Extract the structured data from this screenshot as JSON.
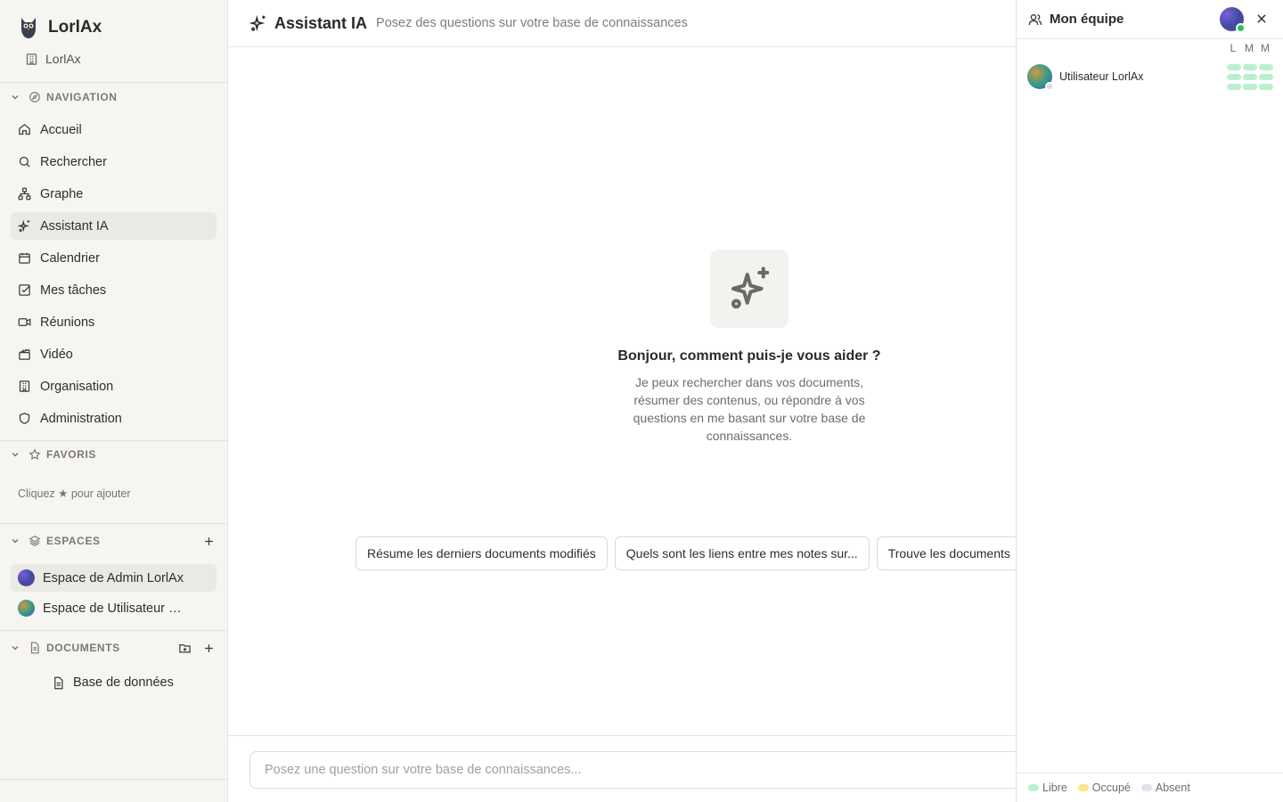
{
  "app": {
    "name": "LorlAx",
    "org": "LorlAx"
  },
  "sidebar": {
    "navigation_label": "NAVIGATION",
    "items": [
      {
        "label": "Accueil",
        "icon": "home-icon"
      },
      {
        "label": "Rechercher",
        "icon": "search-icon"
      },
      {
        "label": "Graphe",
        "icon": "graph-icon"
      },
      {
        "label": "Assistant IA",
        "icon": "sparkles-icon",
        "active": true
      },
      {
        "label": "Calendrier",
        "icon": "calendar-icon"
      },
      {
        "label": "Mes tâches",
        "icon": "checkbox-icon"
      },
      {
        "label": "Réunions",
        "icon": "video-camera-icon"
      },
      {
        "label": "Vidéo",
        "icon": "clapperboard-icon"
      },
      {
        "label": "Organisation",
        "icon": "building-icon"
      },
      {
        "label": "Administration",
        "icon": "shield-icon"
      }
    ],
    "favorites_label": "FAVORIS",
    "favorites_hint": "Cliquez ★ pour ajouter",
    "spaces_label": "ESPACES",
    "spaces": [
      {
        "label": "Espace de Admin LorlAx",
        "active": true
      },
      {
        "label": "Espace de Utilisateur LorlAx",
        "active": false
      }
    ],
    "documents_label": "DOCUMENTS",
    "documents": [
      {
        "label": "Base de données"
      }
    ]
  },
  "header": {
    "title": "Assistant IA",
    "subtitle": "Posez des questions sur votre base de connaissances"
  },
  "main": {
    "greeting": "Bonjour, comment puis-je vous aider ?",
    "description": "Je peux rechercher dans vos documents, résumer des contenus, ou répondre à vos questions en me basant sur votre base de connaissances.",
    "suggestions": [
      "Résume les derniers documents modifiés",
      "Quels sont les liens entre mes notes sur...",
      "Trouve les documents"
    ],
    "composer_placeholder": "Posez une question sur votre base de connaissances..."
  },
  "team_panel": {
    "title": "Mon équipe",
    "days": [
      "L",
      "M",
      "M"
    ],
    "members": [
      {
        "name": "Utilisateur LorlAx",
        "status": "absent"
      }
    ],
    "legend": [
      {
        "label": "Libre",
        "color": "#bbf0cf"
      },
      {
        "label": "Occupé",
        "color": "#fde68a"
      },
      {
        "label": "Absent",
        "color": "#dfe3ea"
      }
    ]
  },
  "colors": {
    "active_bg": "#ebe9e4",
    "sidebar_bg": "#f6f5f2",
    "online": "#22c55e"
  }
}
